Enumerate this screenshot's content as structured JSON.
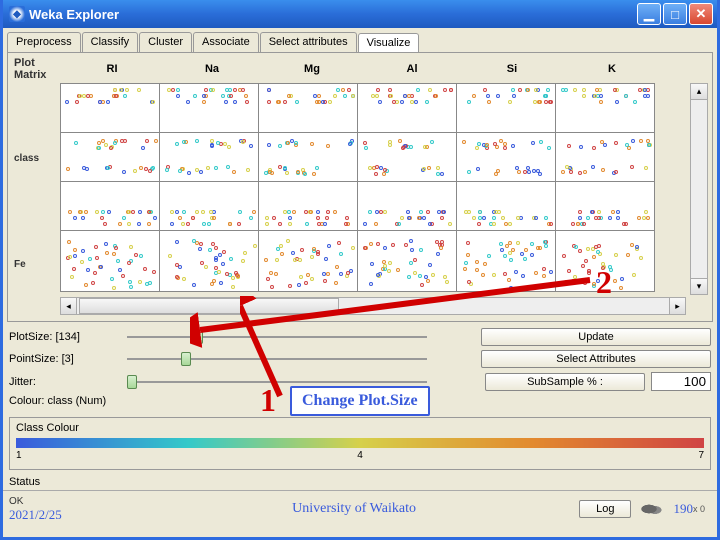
{
  "window": {
    "title": "Weka Explorer"
  },
  "tabs": [
    {
      "label": "Preprocess",
      "active": false
    },
    {
      "label": "Classify",
      "active": false
    },
    {
      "label": "Cluster",
      "active": false
    },
    {
      "label": "Associate",
      "active": false
    },
    {
      "label": "Select attributes",
      "active": false
    },
    {
      "label": "Visualize",
      "active": true
    }
  ],
  "plot_matrix": {
    "title": "Plot Matrix",
    "columns": [
      "RI",
      "Na",
      "Mg",
      "Al",
      "Si",
      "K"
    ],
    "rows": [
      "",
      "class",
      "",
      "Fe"
    ]
  },
  "controls": {
    "plot_size": {
      "label": "PlotSize: [134]",
      "value": 134,
      "min": 50,
      "max": 400,
      "pos_pct": 22
    },
    "point_size": {
      "label": "PointSize: [3]",
      "value": 3,
      "min": 1,
      "max": 10,
      "pos_pct": 18
    },
    "jitter": {
      "label": "Jitter:",
      "value": 0,
      "pos_pct": 0
    },
    "colour": {
      "label": "Colour: class (Num)"
    },
    "update_btn": "Update",
    "select_attr_btn": "Select Attributes",
    "subsample_label": "SubSample % :",
    "subsample_value": "100"
  },
  "class_colour": {
    "title": "Class Colour",
    "scale": [
      "1",
      "4",
      "7"
    ]
  },
  "status": {
    "title": "Status",
    "ok": "OK",
    "date": "2021/2/25",
    "footer": "University of Waikato",
    "log_btn": "Log",
    "page": "190",
    "x0": "x 0"
  },
  "annotations": {
    "num1": "1",
    "num2": "2",
    "callout": "Change Plot.Size"
  }
}
